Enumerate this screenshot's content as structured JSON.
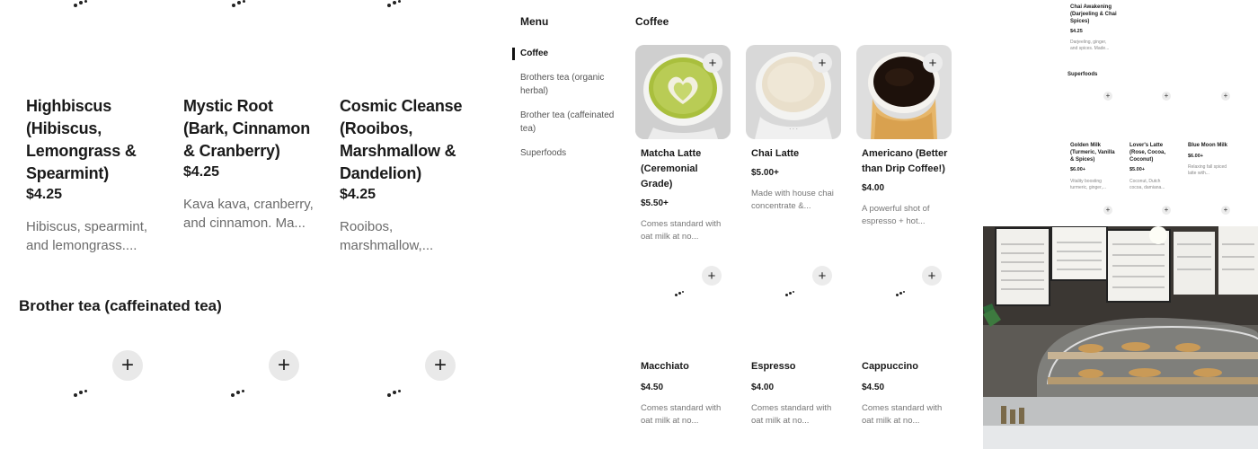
{
  "left_panel": {
    "cards": [
      {
        "name": "Highbiscus (Hibiscus, Lemongrass & Spearmint)",
        "price": "$4.25",
        "desc": "Hibiscus, spearmint, and lemongrass...."
      },
      {
        "name": "Mystic Root (Bark, Cinnamon & Cranberry)",
        "price": "$4.25",
        "desc": "Kava kava, cranberry, and cinnamon. Ma..."
      },
      {
        "name": "Cosmic Cleanse (Rooibos, Marshmallow & Dandelion)",
        "price": "$4.25",
        "desc": "Rooibos, marshmallow,..."
      }
    ],
    "section_title": "Brother tea (caffeinated tea)",
    "add_icon": "plus-icon"
  },
  "menu": {
    "header": "Menu",
    "nav": [
      {
        "label": "Coffee",
        "active": true
      },
      {
        "label": "Brothers tea (organic herbal)",
        "active": false
      },
      {
        "label": "Brother tea (caffeinated tea)",
        "active": false
      },
      {
        "label": "Superfoods",
        "active": false
      }
    ]
  },
  "coffee": {
    "header": "Coffee",
    "items": [
      {
        "name": "Matcha Latte (Ceremonial Grade)",
        "price": "$5.50+",
        "desc": "Comes standard with oat milk at no..."
      },
      {
        "name": "Chai Latte",
        "price": "$5.00+",
        "desc": "Made with house chai concentrate &..."
      },
      {
        "name": "Americano (Better than Drip Coffee!)",
        "price": "$4.00",
        "desc": "A powerful shot of espresso + hot..."
      },
      {
        "name": "Macchiato",
        "price": "$4.50",
        "desc": "Comes standard with oat milk at no..."
      },
      {
        "name": "Espresso",
        "price": "$4.00",
        "desc": "Comes standard with oat milk at no..."
      },
      {
        "name": "Cappuccino",
        "price": "$4.50",
        "desc": "Comes standard with oat milk at no..."
      }
    ]
  },
  "right_panel": {
    "top_item": {
      "name": "Chai Awakening (Darjeeling & Chai Spices)",
      "price": "$4.25",
      "desc": "Darjeeling, ginger, and spices. Made..."
    },
    "section": "Superfoods",
    "items": [
      {
        "name": "Golden Milk (Turmeric, Vanilla & Spices)",
        "price": "$6.00+",
        "desc": "Vitality boosting turmeric, ginger,..."
      },
      {
        "name": "Lover's Latte (Rose, Cocoa, Coconut)",
        "price": "$5.00+",
        "desc": "Coconut, Dutch cocoa, damiana..."
      },
      {
        "name": "Blue Moon Milk",
        "price": "$6.00+",
        "desc": "Relaxing fall spiced latte with..."
      }
    ]
  },
  "colors": {
    "accent": "#111111",
    "muted": "#6b6b6b",
    "plus_bg": "#e9e9e9"
  }
}
